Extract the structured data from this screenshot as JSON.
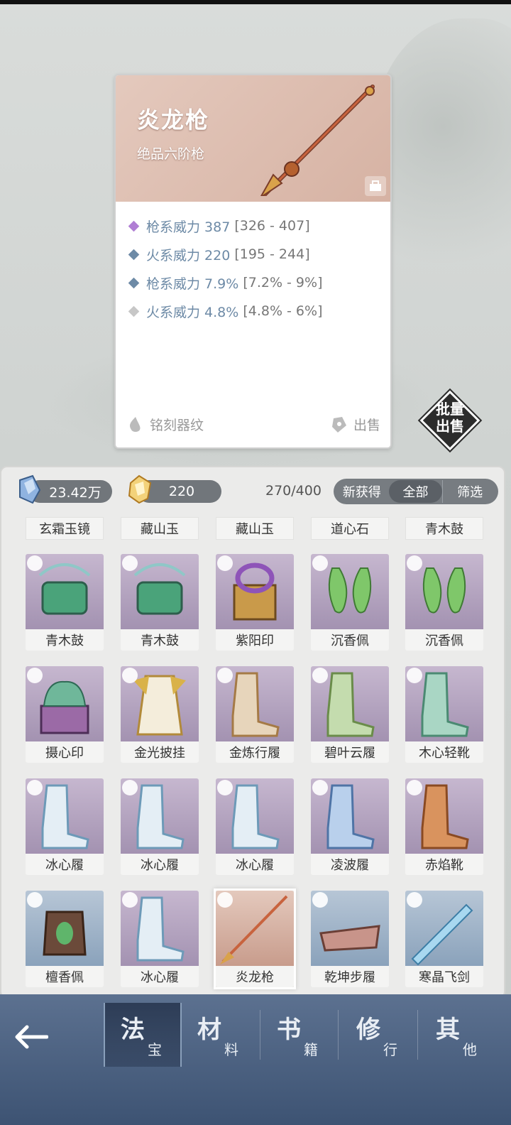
{
  "item": {
    "name": "炎龙枪",
    "grade": "绝品六阶枪",
    "stats": [
      {
        "name": "枪系威力 387",
        "range": "[326 - 407]",
        "color": "#b07ed4"
      },
      {
        "name": "火系威力 220",
        "range": "[195 - 244]",
        "color": "#6d8aa6"
      },
      {
        "name": "枪系威力 7.9%",
        "range": "[7.2% - 9%]",
        "color": "#6d8aa6"
      },
      {
        "name": "火系威力 4.8%",
        "range": "[4.8% - 6%]",
        "color": "#c7c7c7"
      }
    ],
    "engrave_label": "铭刻器纹",
    "sell_label": "出售"
  },
  "bulk_sell": {
    "line1": "批量",
    "line2": "出售"
  },
  "resources": {
    "spirit_stones": "23.42万",
    "gems": "220"
  },
  "capacity": "270/400",
  "filter_tabs": [
    "新获得",
    "全部",
    "筛选"
  ],
  "active_tab": "全部",
  "inventory": {
    "top_row": [
      "玄霜玉镜",
      "藏山玉",
      "藏山玉",
      "道心石",
      "青木鼓"
    ],
    "rows": [
      [
        {
          "name": "青木鼓"
        },
        {
          "name": "青木鼓"
        },
        {
          "name": "紫阳印"
        },
        {
          "name": "沉香佩"
        },
        {
          "name": "沉香佩"
        }
      ],
      [
        {
          "name": "摄心印"
        },
        {
          "name": "金光披挂"
        },
        {
          "name": "金炼行履"
        },
        {
          "name": "碧叶云履"
        },
        {
          "name": "木心轻靴"
        }
      ],
      [
        {
          "name": "冰心履"
        },
        {
          "name": "冰心履"
        },
        {
          "name": "冰心履"
        },
        {
          "name": "凌波履"
        },
        {
          "name": "赤焰靴"
        }
      ],
      [
        {
          "name": "檀香佩"
        },
        {
          "name": "冰心履"
        },
        {
          "name": "炎龙枪"
        },
        {
          "name": "乾坤步履"
        },
        {
          "name": "寒晶飞剑"
        }
      ]
    ]
  },
  "nav": [
    {
      "big": "法",
      "small": "宝"
    },
    {
      "big": "材",
      "small": "料"
    },
    {
      "big": "书",
      "small": "籍"
    },
    {
      "big": "修",
      "small": "行"
    },
    {
      "big": "其",
      "small": "他"
    }
  ]
}
